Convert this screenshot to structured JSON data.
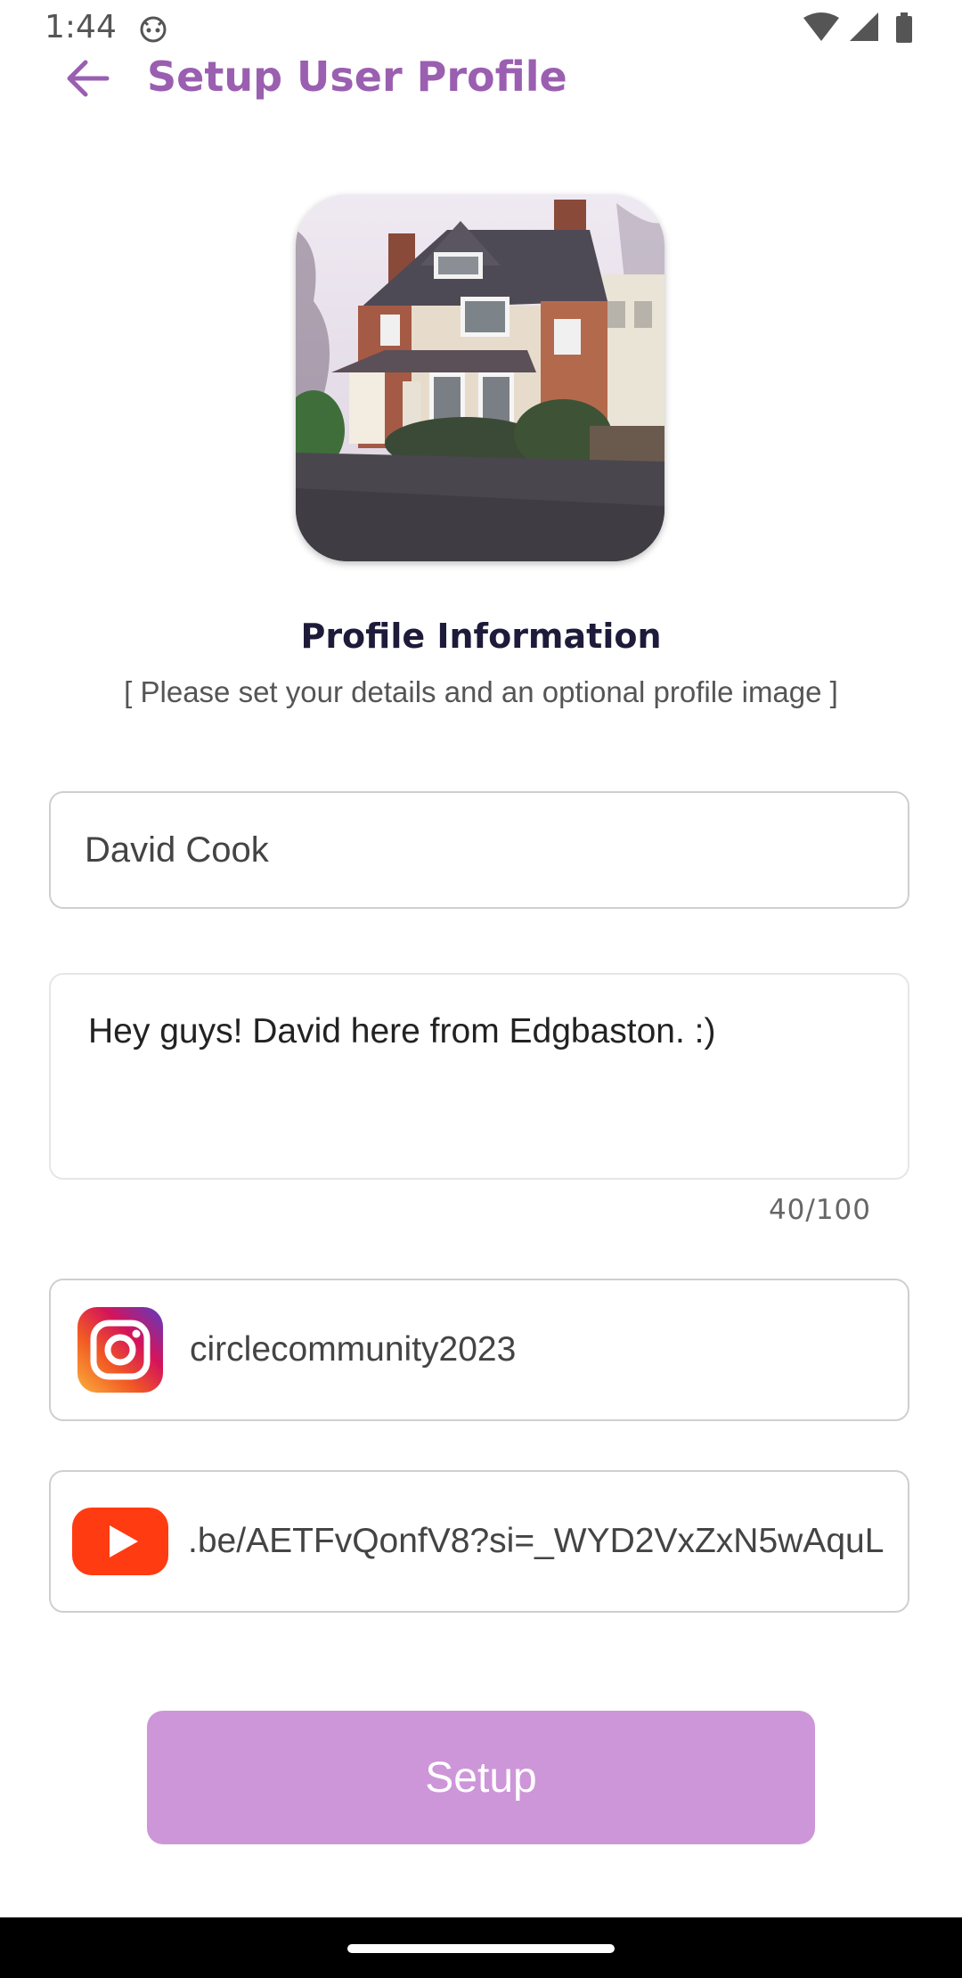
{
  "status_bar": {
    "time": "1:44",
    "icons": [
      "android-face-icon",
      "wifi-icon",
      "cell-signal-icon",
      "battery-icon"
    ]
  },
  "app_bar": {
    "title": "Setup User Profile",
    "back_icon": "arrow-left-icon"
  },
  "profile": {
    "image_description_icon": "house-photo",
    "section_title": "Profile Information",
    "section_subtitle": "[ Please set your details and an optional profile image ]"
  },
  "form": {
    "name_value": "David Cook",
    "bio_value": "Hey guys! David here from Edgbaston. :)",
    "bio_counter": "40/100",
    "instagram_value": "circlecommunity2023",
    "instagram_icon": "instagram-icon",
    "youtube_value": ".be/AETFvQonfV8?si=_WYD2VxZxN5wAquL",
    "youtube_icon": "youtube-icon"
  },
  "actions": {
    "setup_label": "Setup"
  },
  "colors": {
    "accent": "#9a5fb0",
    "button_bg": "#cd96d8",
    "heading": "#1e1b3a"
  }
}
